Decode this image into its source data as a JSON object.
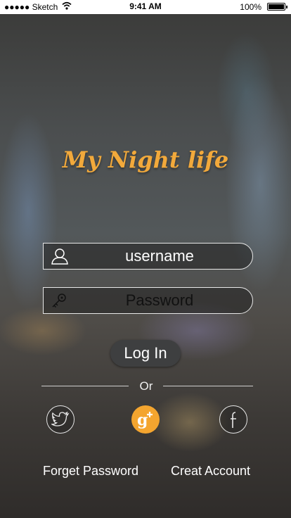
{
  "status_bar": {
    "carrier": "●●●●● Sketch",
    "time": "9:41 AM",
    "battery": "100%"
  },
  "app": {
    "title": "My Night life"
  },
  "form": {
    "username_placeholder": "username",
    "password_placeholder": "Password",
    "login_label": "Log In"
  },
  "divider": {
    "or_label": "Or"
  },
  "social": {
    "icons": [
      "twitter-icon",
      "google-plus-icon",
      "facebook-icon"
    ],
    "google_color": "#f4a52f"
  },
  "links": {
    "forgot_password": "Forget Password",
    "create_account": "Creat Account"
  },
  "colors": {
    "title": "#f2a93b",
    "button": "#3e3f40"
  }
}
